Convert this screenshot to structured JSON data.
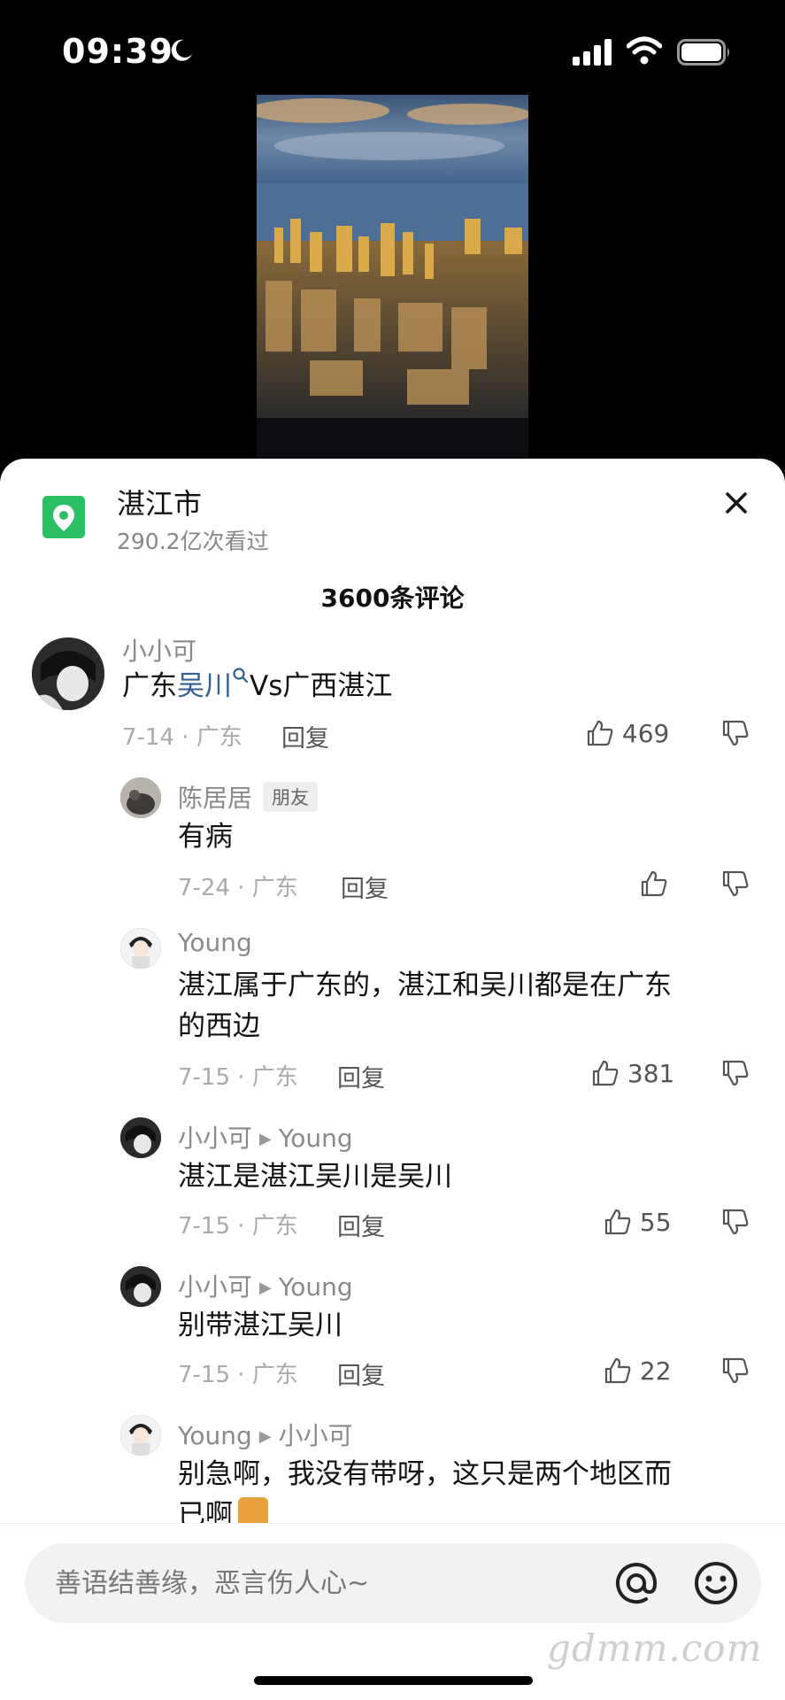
{
  "status_bar": {
    "time": "09:39"
  },
  "location": {
    "name": "湛江市",
    "views": "290.2亿次看过"
  },
  "comments_header": "3600条评论",
  "comments": [
    {
      "author": "小小可",
      "text_parts": [
        "广东",
        "吴川",
        "Vs广西湛江"
      ],
      "meta": "7-14 · 广东",
      "reply": "回复",
      "likes": "469"
    },
    {
      "author": "陈居居",
      "badge": "朋友",
      "text": "有病",
      "meta": "7-24 · 广东",
      "reply": "回复",
      "likes": ""
    },
    {
      "author": "Young",
      "text_lines": [
        "湛江属于广东的，湛江和吴川都是在广东",
        "的西边"
      ],
      "meta": "7-15 · 广东",
      "reply": "回复",
      "likes": "381"
    },
    {
      "author": "小小可",
      "reply_to": "Young",
      "text": "湛江是湛江吴川是吴川",
      "meta": "7-15 · 广东",
      "reply": "回复",
      "likes": "55"
    },
    {
      "author": "小小可",
      "reply_to": "Young",
      "text": "别带湛江吴川",
      "meta": "7-15 · 广东",
      "reply": "回复",
      "likes": "22"
    },
    {
      "author": "Young",
      "reply_to": "小小可",
      "text_lines": [
        "别急啊，我没有带呀，这只是两个地区而",
        "已啊"
      ]
    }
  ],
  "input": {
    "placeholder": "善语结善缘，恶言伤人心~"
  },
  "watermark": "gdmm.com",
  "icons": [
    "moon-icon",
    "signal-icon",
    "wifi-icon",
    "battery-icon",
    "location-pin-icon",
    "close-icon",
    "thumb-up-icon",
    "thumb-down-icon",
    "search-icon",
    "at-icon",
    "emoji-icon"
  ],
  "colors": {
    "location_green": "#2dbf64",
    "link_blue": "#2f5f96",
    "sheet_bg": "#ffffff"
  }
}
